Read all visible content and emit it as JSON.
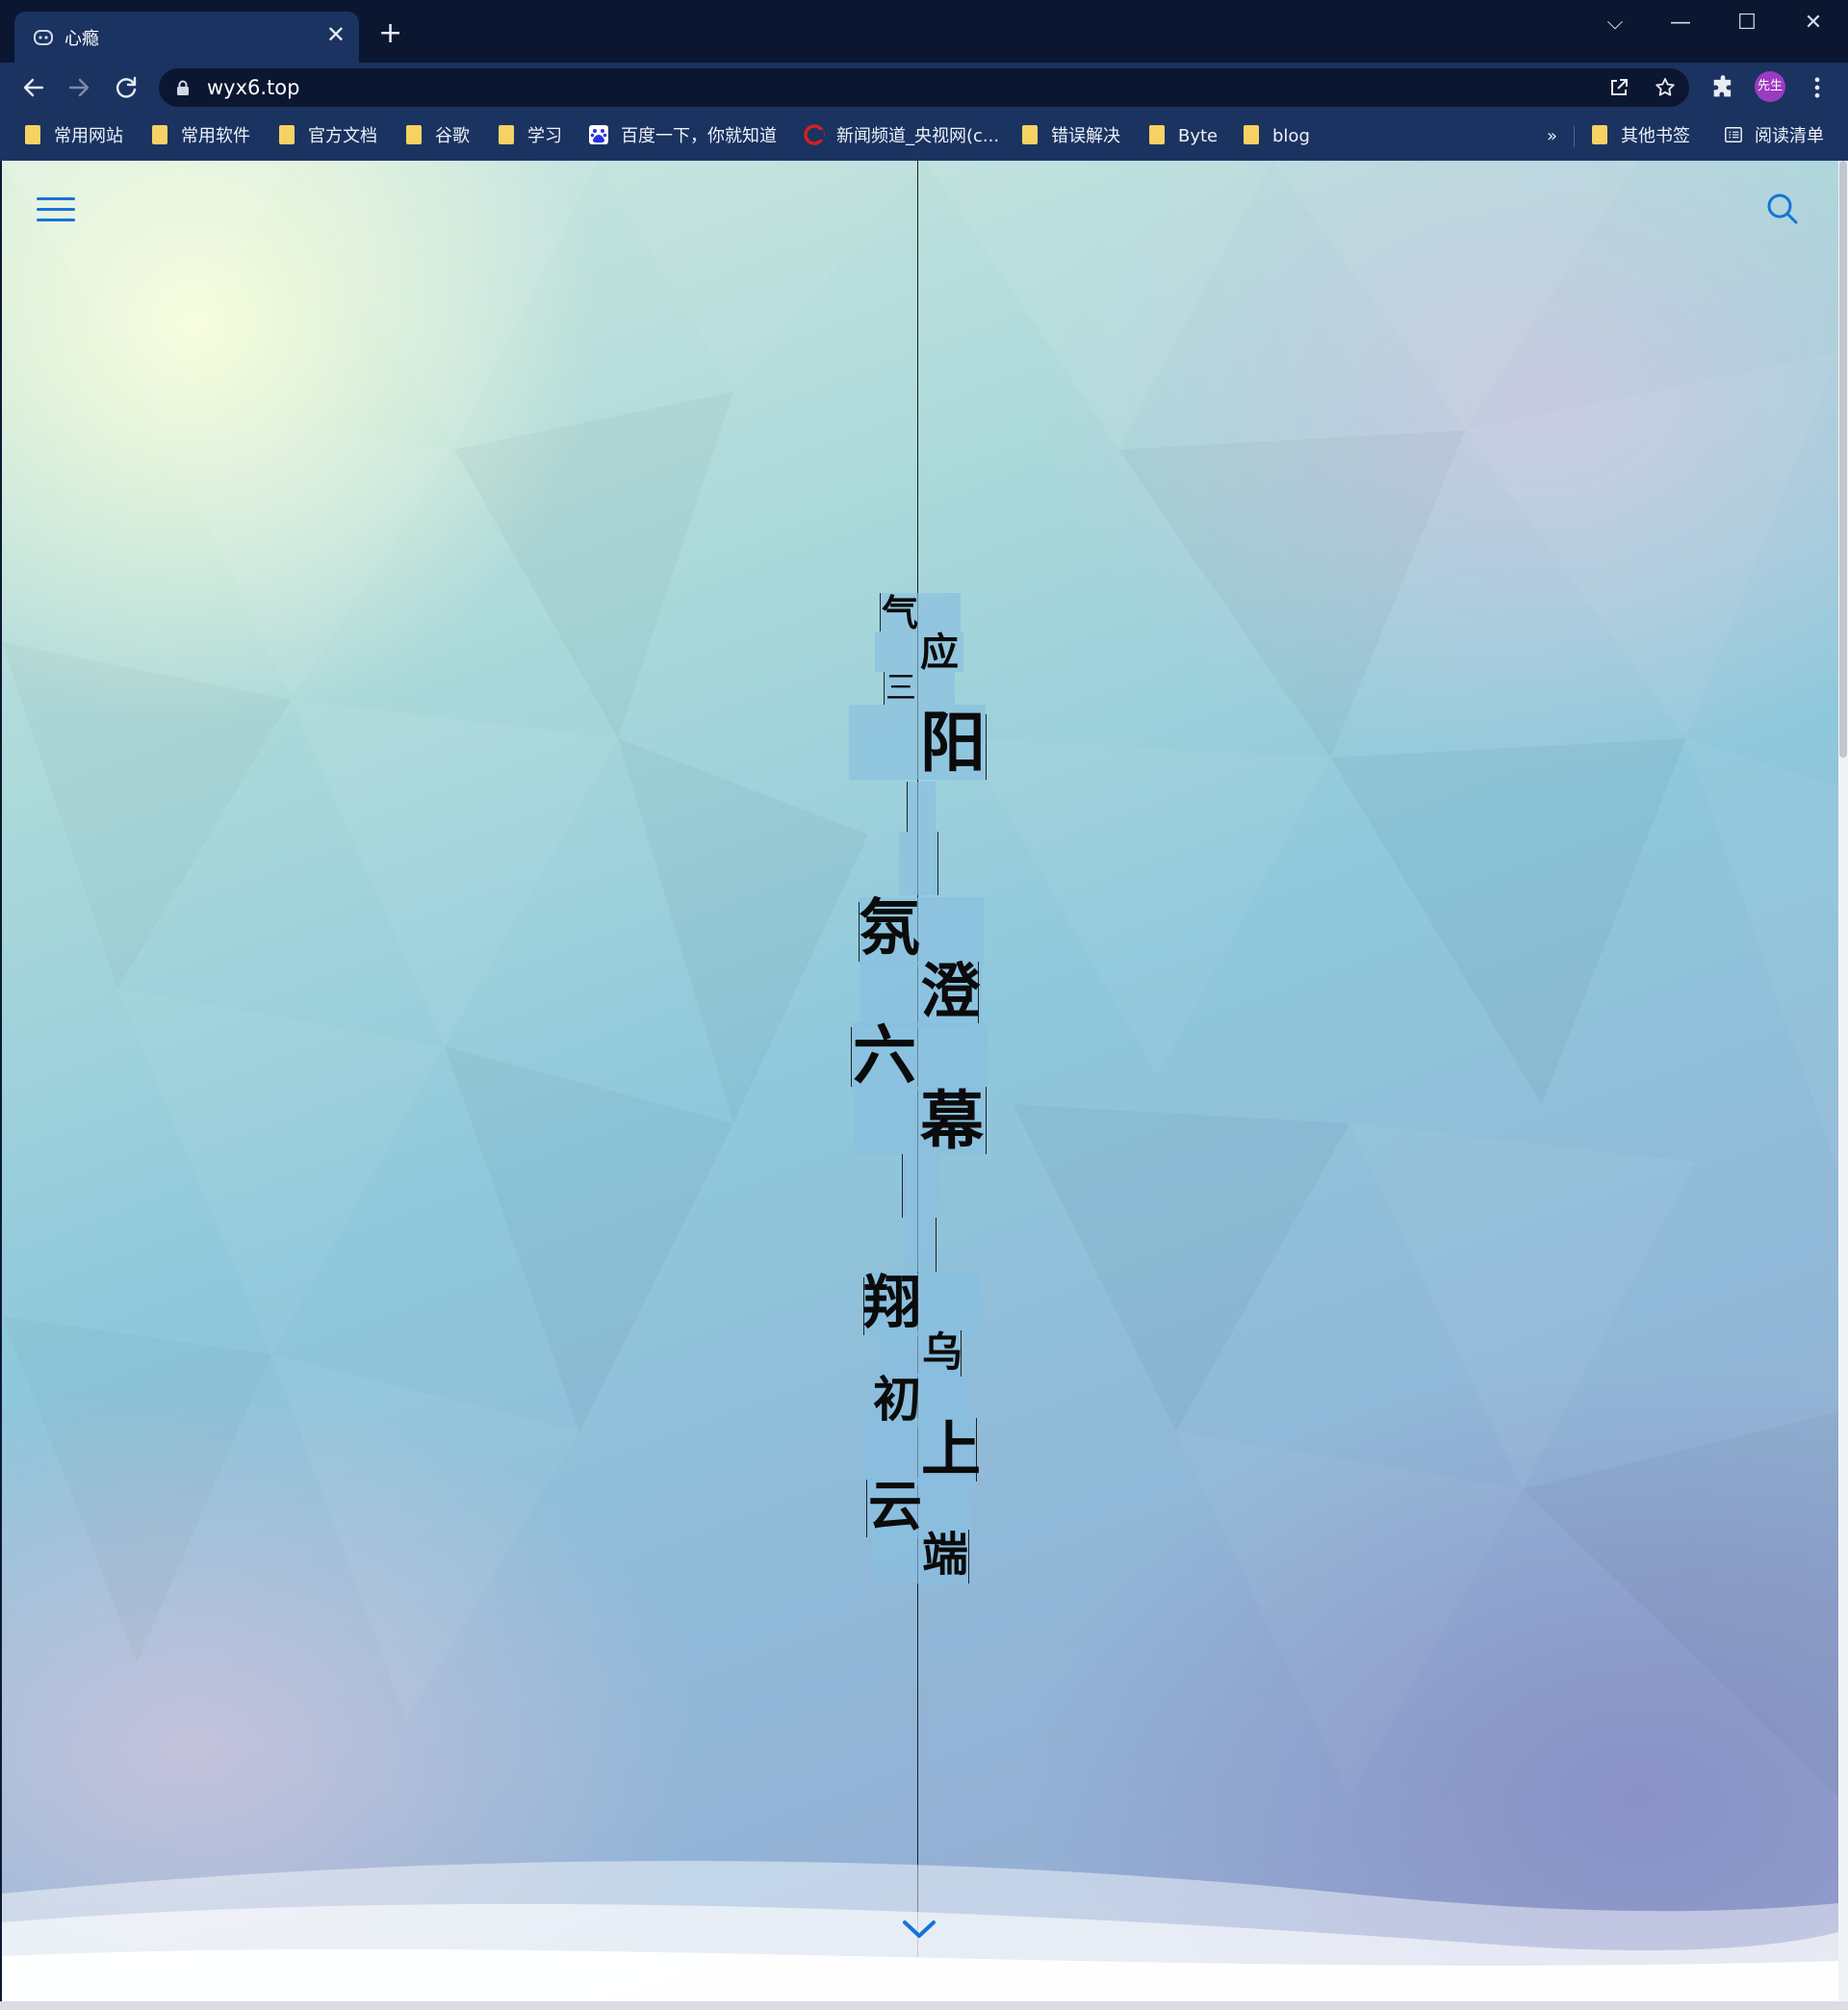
{
  "browser": {
    "tab": {
      "title": "心瘾",
      "close_glyph": "✕"
    },
    "new_tab_glyph": "+",
    "window_controls": {
      "dropdown": "⌵",
      "minimize": "—",
      "maximize": "☐",
      "close": "✕"
    },
    "address": {
      "url": "wyx6.top"
    },
    "profile_avatar_text": "先生",
    "bookmarks": [
      {
        "label": "常用网站",
        "icon": "folder-icon"
      },
      {
        "label": "常用软件",
        "icon": "folder-icon"
      },
      {
        "label": "官方文档",
        "icon": "folder-icon"
      },
      {
        "label": "谷歌",
        "icon": "folder-icon"
      },
      {
        "label": "学习",
        "icon": "folder-icon"
      },
      {
        "label": "百度一下，你就知道",
        "icon": "baidu-icon"
      },
      {
        "label": "新闻频道_央视网(c...",
        "icon": "cctv-icon"
      },
      {
        "label": "错误解决",
        "icon": "folder-icon"
      },
      {
        "label": "Byte",
        "icon": "folder-icon"
      },
      {
        "label": "blog",
        "icon": "folder-icon"
      }
    ],
    "bookmarks_overflow": "»",
    "other_bookmarks": "其他书签",
    "reading_list": "阅读清单"
  },
  "page": {
    "poem": [
      "气",
      "应",
      "三",
      "阳",
      "氛",
      "澄",
      "六",
      "幕",
      "翔",
      "乌",
      "初",
      "上",
      "云",
      "端"
    ],
    "accent_color": "#1673d8"
  }
}
